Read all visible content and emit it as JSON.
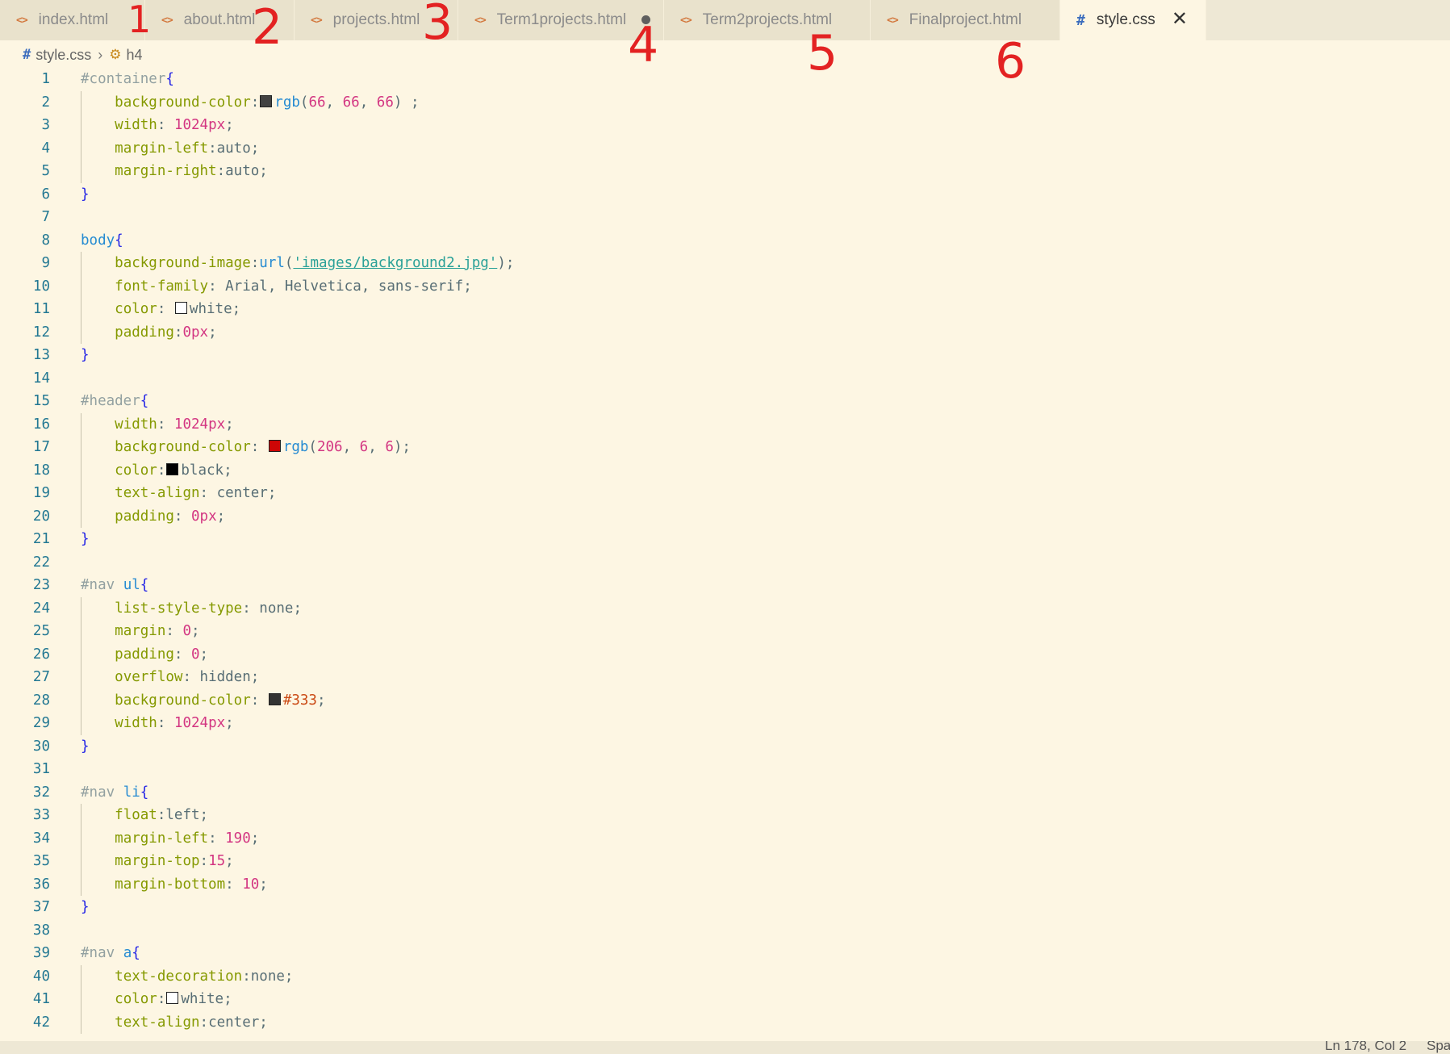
{
  "tabs": [
    {
      "label": "index.html",
      "icon": "html-file-icon",
      "annotation": "1"
    },
    {
      "label": "about.html",
      "icon": "html-file-icon",
      "annotation": "2"
    },
    {
      "label": "projects.html",
      "icon": "html-file-icon",
      "annotation": "3"
    },
    {
      "label": "Term1projects.html",
      "icon": "html-file-icon",
      "annotation": "4",
      "unsaved": true
    },
    {
      "label": "Term2projects.html",
      "icon": "html-file-icon",
      "annotation": "5"
    },
    {
      "label": "Finalproject.html",
      "icon": "html-file-icon",
      "annotation": "6"
    },
    {
      "label": "style.css",
      "icon": "css-file-icon",
      "active": true
    }
  ],
  "breadcrumb": {
    "file": "style.css",
    "symbol": "h4"
  },
  "colors": {
    "editor_bg": "#fdf6e3",
    "tabbar_bg": "#eee8d5",
    "annotation": "#e32222",
    "swatch_container": "#424242",
    "swatch_header": "#ce0606",
    "swatch_nav": "#333333",
    "swatch_white": "#ffffff",
    "swatch_black": "#000000"
  },
  "code_lines": [
    {
      "n": "1",
      "text": "#container{"
    },
    {
      "n": "2",
      "text": "    background-color:rgb(66, 66, 66) ;"
    },
    {
      "n": "3",
      "text": "    width: 1024px;"
    },
    {
      "n": "4",
      "text": "    margin-left:auto;"
    },
    {
      "n": "5",
      "text": "    margin-right:auto;"
    },
    {
      "n": "6",
      "text": "}"
    },
    {
      "n": "7",
      "text": ""
    },
    {
      "n": "8",
      "text": "body{"
    },
    {
      "n": "9",
      "text": "    background-image:url('images/background2.jpg');"
    },
    {
      "n": "10",
      "text": "    font-family: Arial, Helvetica, sans-serif;"
    },
    {
      "n": "11",
      "text": "    color: white;"
    },
    {
      "n": "12",
      "text": "    padding:0px;"
    },
    {
      "n": "13",
      "text": "}"
    },
    {
      "n": "14",
      "text": ""
    },
    {
      "n": "15",
      "text": "#header{"
    },
    {
      "n": "16",
      "text": "    width: 1024px;"
    },
    {
      "n": "17",
      "text": "    background-color: rgb(206, 6, 6);"
    },
    {
      "n": "18",
      "text": "    color:black;"
    },
    {
      "n": "19",
      "text": "    text-align: center;"
    },
    {
      "n": "20",
      "text": "    padding: 0px;"
    },
    {
      "n": "21",
      "text": "}"
    },
    {
      "n": "22",
      "text": ""
    },
    {
      "n": "23",
      "text": "#nav ul{"
    },
    {
      "n": "24",
      "text": "    list-style-type: none;"
    },
    {
      "n": "25",
      "text": "    margin: 0;"
    },
    {
      "n": "26",
      "text": "    padding: 0;"
    },
    {
      "n": "27",
      "text": "    overflow: hidden;"
    },
    {
      "n": "28",
      "text": "    background-color: #333;"
    },
    {
      "n": "29",
      "text": "    width: 1024px;"
    },
    {
      "n": "30",
      "text": "}"
    },
    {
      "n": "31",
      "text": ""
    },
    {
      "n": "32",
      "text": "#nav li{"
    },
    {
      "n": "33",
      "text": "    float:left;"
    },
    {
      "n": "34",
      "text": "    margin-left: 190;"
    },
    {
      "n": "35",
      "text": "    margin-top:15;"
    },
    {
      "n": "36",
      "text": "    margin-bottom: 10;"
    },
    {
      "n": "37",
      "text": "}"
    },
    {
      "n": "38",
      "text": ""
    },
    {
      "n": "39",
      "text": "#nav a{"
    },
    {
      "n": "40",
      "text": "    text-decoration:none;"
    },
    {
      "n": "41",
      "text": "    color:white;"
    },
    {
      "n": "42",
      "text": "    text-align:center;"
    }
  ],
  "status": {
    "position": "Ln 178, Col 2",
    "indent": "Spa"
  }
}
